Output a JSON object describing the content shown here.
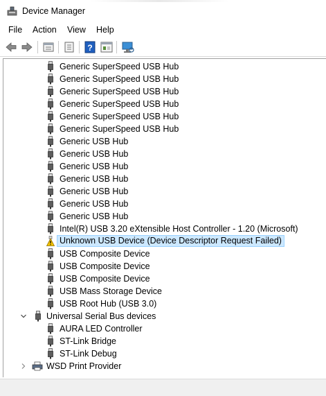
{
  "window": {
    "title": "Device Manager"
  },
  "menu": [
    "File",
    "Action",
    "View",
    "Help"
  ],
  "toolbar": {
    "buttons": [
      "back-icon",
      "forward-icon",
      "properties-icon",
      "update-driver-icon",
      "help-icon",
      "show-hidden-icon",
      "scan-hardware-icon"
    ]
  },
  "tree": {
    "usb_controllers_children": [
      "Generic SuperSpeed USB Hub",
      "Generic SuperSpeed USB Hub",
      "Generic SuperSpeed USB Hub",
      "Generic SuperSpeed USB Hub",
      "Generic SuperSpeed USB Hub",
      "Generic SuperSpeed USB Hub",
      "Generic USB Hub",
      "Generic USB Hub",
      "Generic USB Hub",
      "Generic USB Hub",
      "Generic USB Hub",
      "Generic USB Hub",
      "Generic USB Hub",
      "Intel(R) USB 3.20 eXtensible Host Controller - 1.20 (Microsoft)",
      "Unknown USB Device (Device Descriptor Request Failed)",
      "USB Composite Device",
      "USB Composite Device",
      "USB Composite Device",
      "USB Mass Storage Device",
      "USB Root Hub (USB 3.0)"
    ],
    "usb_devices": {
      "label": "Universal Serial Bus devices",
      "children": [
        "AURA LED Controller",
        "ST-Link Bridge",
        "ST-Link Debug"
      ]
    },
    "wsd": {
      "label": "WSD Print Provider"
    },
    "selected_label": "Unknown USB Device (Device Descriptor Request Failed)"
  },
  "colors": {
    "selection_bg": "#cce8ff",
    "selection_border": "#99d1ff",
    "warning": "#f5c400"
  }
}
